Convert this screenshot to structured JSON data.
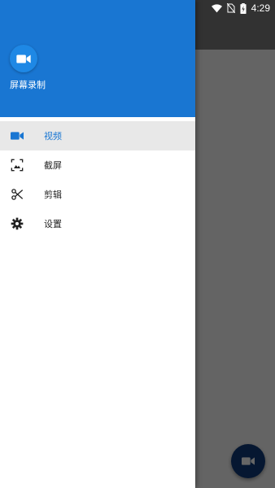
{
  "status_bar": {
    "time": "4:29",
    "icons": [
      "wifi-icon",
      "no-sim-icon",
      "battery-charging-icon"
    ]
  },
  "drawer": {
    "header": {
      "logo_icon": "video-camera-icon",
      "app_name": "屏幕录制"
    },
    "items": [
      {
        "label": "视频",
        "icon": "video-camera-icon",
        "active": true
      },
      {
        "label": "截屏",
        "icon": "screenshot-icon",
        "active": false
      },
      {
        "label": "剪辑",
        "icon": "scissors-icon",
        "active": false
      },
      {
        "label": "设置",
        "icon": "gear-icon",
        "active": false
      }
    ]
  },
  "fab": {
    "icon": "video-camera-icon"
  },
  "colors": {
    "primary": "#1976d2",
    "active_item_bg": "#e8e8e8",
    "fab": "#0f3b7a"
  }
}
